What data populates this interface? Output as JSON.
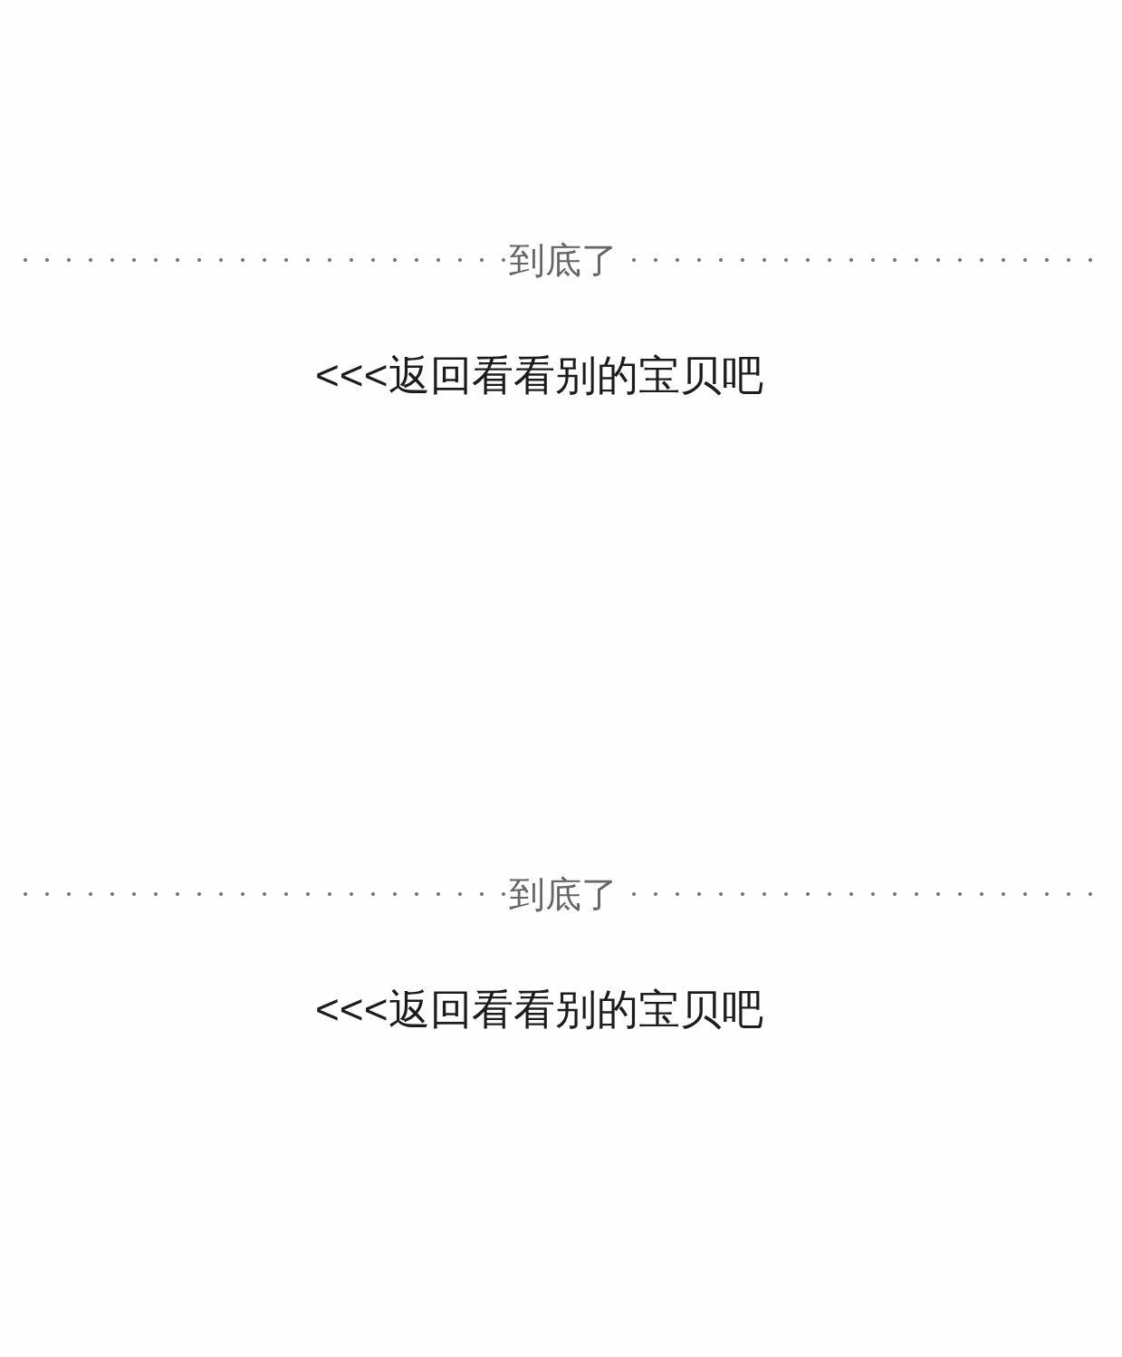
{
  "sections": [
    {
      "divider": {
        "label": "到底了"
      },
      "back_link": {
        "label": "<<<返回看看别的宝贝吧"
      }
    },
    {
      "divider": {
        "label": "到底了"
      },
      "back_link": {
        "label": "<<<返回看看别的宝贝吧"
      }
    }
  ]
}
